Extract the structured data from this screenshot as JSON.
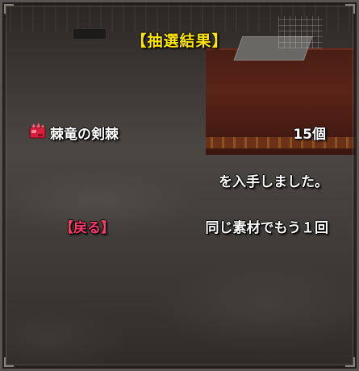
{
  "dialog": {
    "title": "【抽選結果】",
    "item": {
      "icon": "crimson-monster-part-icon",
      "name": "棘竜の剣棘",
      "quantity": "15個"
    },
    "message": "を入手しました。",
    "actions": {
      "back_label": "【戻る】",
      "again_label": "同じ素材でもう１回"
    }
  },
  "colors": {
    "title": "#ffe600",
    "text": "#ffffff",
    "back": "#ff3a6a",
    "icon": "#d81e3c"
  }
}
